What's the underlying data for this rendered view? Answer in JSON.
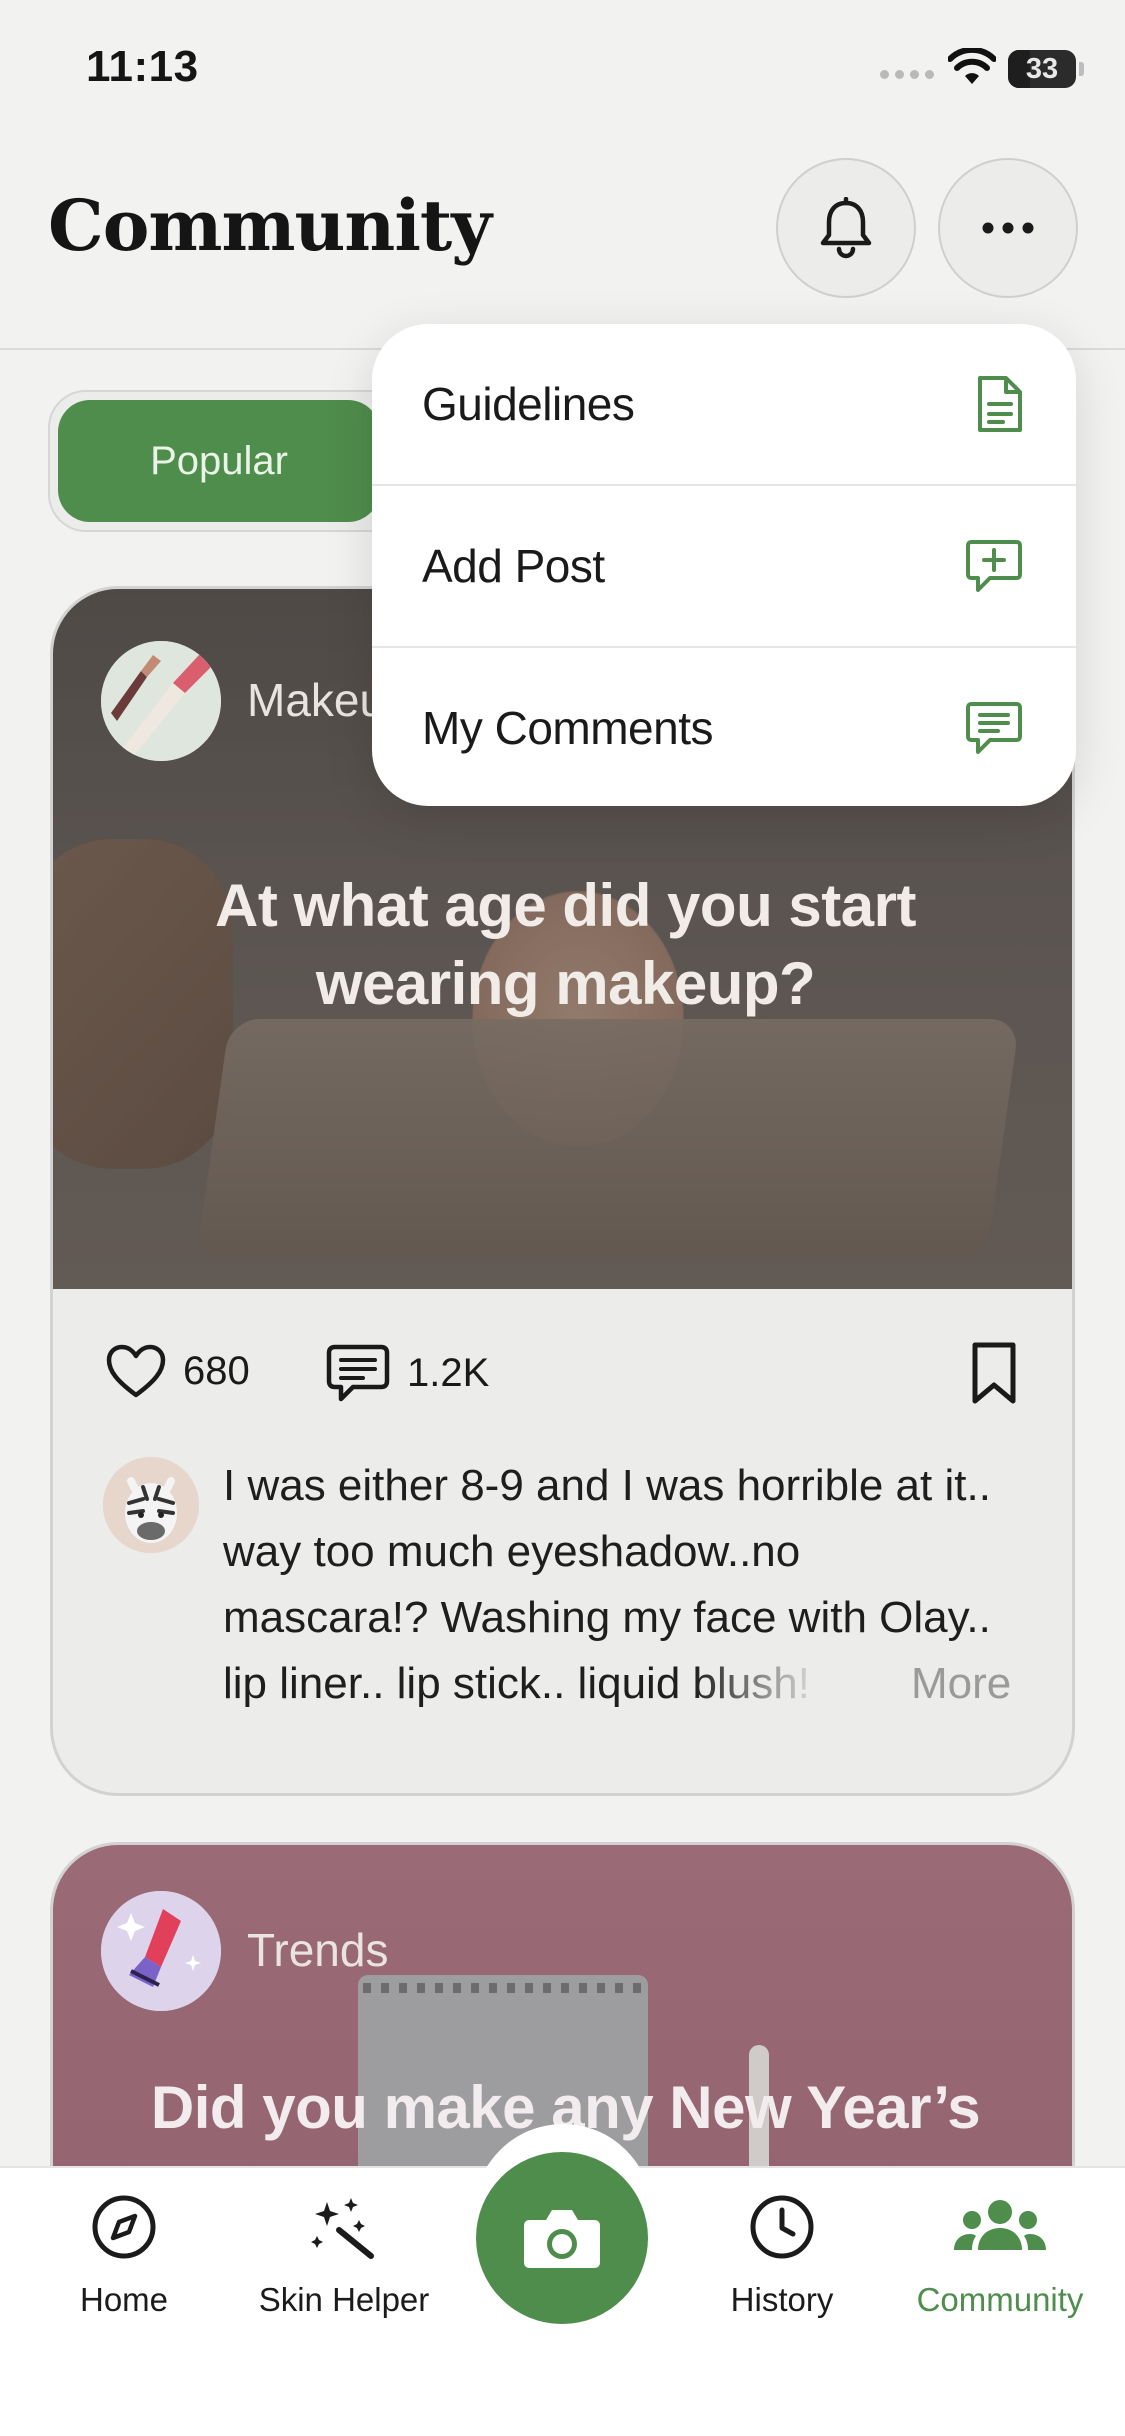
{
  "status_bar": {
    "time": "11:13",
    "battery": "33",
    "battery_fraction": 0.33
  },
  "header": {
    "title": "Community"
  },
  "tabs_filter": {
    "active": "Popular"
  },
  "menu": {
    "items": [
      {
        "label": "Guidelines",
        "icon": "document-icon"
      },
      {
        "label": "Add Post",
        "icon": "message-plus-icon"
      },
      {
        "label": "My Comments",
        "icon": "message-lines-icon"
      }
    ]
  },
  "posts": [
    {
      "category": "Makeup",
      "category_visible": "Makeu",
      "title": "At what age did you start wearing makeup?",
      "likes": "680",
      "comments": "1.2K",
      "top_comment": "I was either 8-9 and I was horrible at it.. way too much eyeshadow..no mascara!? Washing my face with Olay.. lip liner.. lip stick.. liquid blush! I fi",
      "more_label": "More"
    },
    {
      "category": "Trends",
      "title": "Did you make any New Year’s"
    }
  ],
  "tabbar": {
    "items": [
      {
        "label": "Home",
        "icon": "compass-icon"
      },
      {
        "label": "Skin Helper",
        "icon": "magic-wand-icon"
      },
      {
        "label": "History",
        "icon": "clock-icon"
      },
      {
        "label": "Community",
        "icon": "people-icon"
      }
    ],
    "active": "Community"
  },
  "colors": {
    "accent": "#4f8d4c",
    "background": "#f2f2f1",
    "card": "#ececeb",
    "text": "#151515"
  }
}
